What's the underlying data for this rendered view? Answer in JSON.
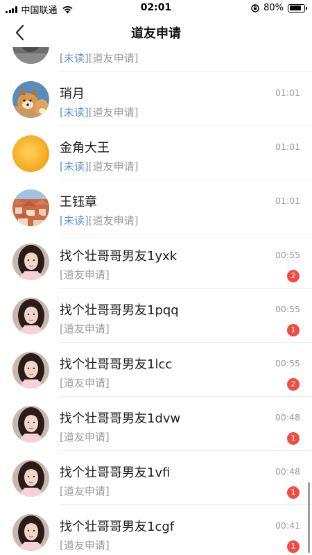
{
  "status_bar": {
    "carrier": "中国联通",
    "time": "02:01",
    "battery_percent": "80%",
    "battery_level": 0.8,
    "icons": [
      "signal-icon",
      "wifi-icon",
      "orientation-lock-icon",
      "battery-icon"
    ]
  },
  "nav": {
    "title": "道友申请",
    "back_icon": "chevron-left-icon"
  },
  "list": [
    {
      "name": "",
      "time": "",
      "unread_tag": "[未读]",
      "sub": "[道友申请]",
      "badge": "",
      "avatar": "gray"
    },
    {
      "name": "琑月",
      "time": "01:01",
      "unread_tag": "[未读]",
      "sub": "[道友申请]",
      "badge": "",
      "avatar": "dog"
    },
    {
      "name": "金角大王",
      "time": "01:01",
      "unread_tag": "[未读]",
      "sub": "[道友申请]",
      "badge": "",
      "avatar": "orange"
    },
    {
      "name": "王钰章",
      "time": "01:01",
      "unread_tag": "[未读]",
      "sub": "[道友申请]",
      "badge": "",
      "avatar": "town"
    },
    {
      "name": "找个壮哥哥男友1yxk",
      "time": "00:55",
      "unread_tag": "",
      "sub": "[道友申请]",
      "badge": "2",
      "avatar": "girl"
    },
    {
      "name": "找个壮哥哥男友1pqq",
      "time": "00:55",
      "unread_tag": "",
      "sub": "[道友申请]",
      "badge": "1",
      "avatar": "girl"
    },
    {
      "name": "找个壮哥哥男友1lcc",
      "time": "00:55",
      "unread_tag": "",
      "sub": "[道友申请]",
      "badge": "2",
      "avatar": "girl"
    },
    {
      "name": "找个壮哥哥男友1dvw",
      "time": "00:48",
      "unread_tag": "",
      "sub": "[道友申请]",
      "badge": "1",
      "avatar": "girl"
    },
    {
      "name": "找个壮哥哥男友1vfi",
      "time": "00:48",
      "unread_tag": "",
      "sub": "[道友申请]",
      "badge": "1",
      "avatar": "girl"
    },
    {
      "name": "找个壮哥哥男友1cgf",
      "time": "00:41",
      "unread_tag": "",
      "sub": "[道友申请]",
      "badge": "1",
      "avatar": "girl"
    }
  ]
}
